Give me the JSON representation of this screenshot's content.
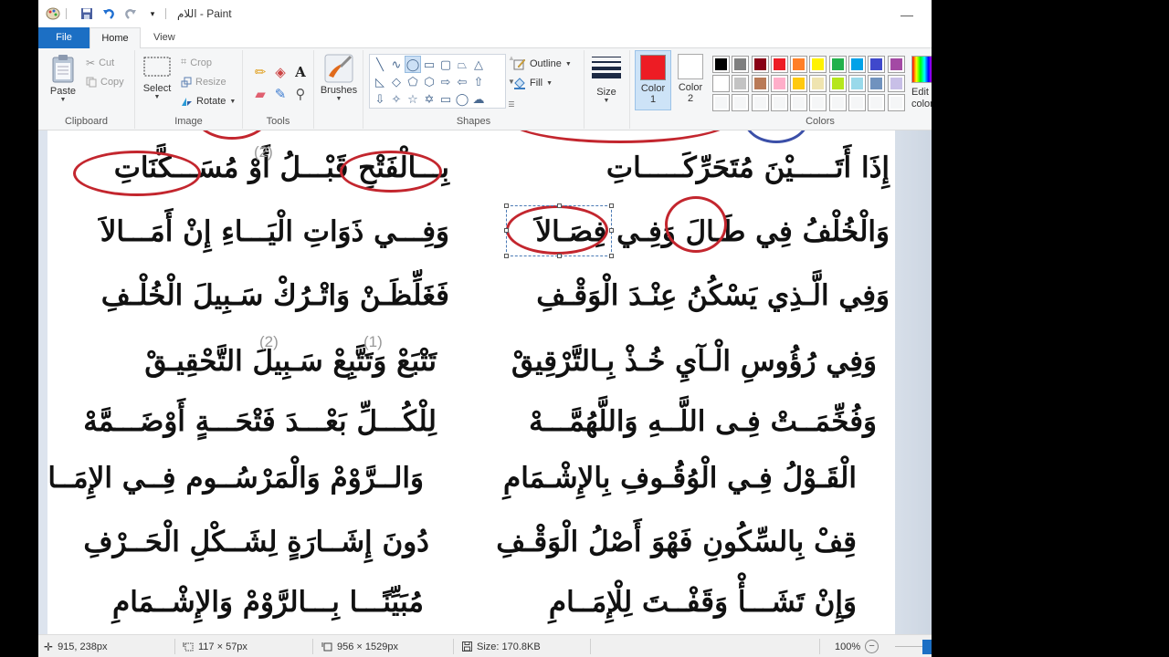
{
  "window": {
    "title": "اللام - Paint",
    "minimize_glyph": "—"
  },
  "quick_access": [
    {
      "name": "paint-app-icon",
      "glyph": "🎨"
    },
    {
      "name": "save-icon",
      "glyph": "💾"
    },
    {
      "name": "undo-icon",
      "glyph": "↶"
    },
    {
      "name": "redo-icon",
      "glyph": "↷"
    },
    {
      "name": "customize-dropdown-icon",
      "glyph": "▾"
    }
  ],
  "tabs": {
    "file": "File",
    "home": "Home",
    "view": "View"
  },
  "ribbon": {
    "clipboard": {
      "label": "Clipboard",
      "paste": "Paste",
      "cut": "Cut",
      "copy": "Copy"
    },
    "image": {
      "label": "Image",
      "select": "Select",
      "crop": "Crop",
      "resize": "Resize",
      "rotate": "Rotate"
    },
    "tools": {
      "label": "Tools",
      "items": [
        {
          "name": "pencil-icon",
          "glyph": "✏"
        },
        {
          "name": "fill-bucket-icon",
          "glyph": "◈"
        },
        {
          "name": "text-tool-icon",
          "glyph": "A"
        },
        {
          "name": "eraser-icon",
          "glyph": "▰"
        },
        {
          "name": "color-picker-icon",
          "glyph": "✎"
        },
        {
          "name": "magnifier-icon",
          "glyph": "⚲"
        }
      ]
    },
    "brushes": {
      "label": "Brushes"
    },
    "shapes": {
      "label": "Shapes",
      "outline": "Outline",
      "fill": "Fill",
      "items": [
        {
          "name": "line-shape",
          "glyph": "╲"
        },
        {
          "name": "curve-shape",
          "glyph": "∿"
        },
        {
          "name": "oval-shape",
          "glyph": "◯",
          "selected": true
        },
        {
          "name": "rectangle-shape",
          "glyph": "▭"
        },
        {
          "name": "rounded-rectangle-shape",
          "glyph": "▢"
        },
        {
          "name": "polygon-shape",
          "glyph": "⏢"
        },
        {
          "name": "triangle-shape",
          "glyph": "△"
        },
        {
          "name": "right-triangle-shape",
          "glyph": "◺"
        },
        {
          "name": "diamond-shape",
          "glyph": "◇"
        },
        {
          "name": "pentagon-shape",
          "glyph": "⬠"
        },
        {
          "name": "hexagon-shape",
          "glyph": "⬡"
        },
        {
          "name": "right-arrow-shape",
          "glyph": "⇨"
        },
        {
          "name": "left-arrow-shape",
          "glyph": "⇦"
        },
        {
          "name": "up-arrow-shape",
          "glyph": "⇧"
        },
        {
          "name": "down-arrow-shape",
          "glyph": "⇩"
        },
        {
          "name": "four-point-star-shape",
          "glyph": "✧"
        },
        {
          "name": "five-point-star-shape",
          "glyph": "☆"
        },
        {
          "name": "six-point-star-shape",
          "glyph": "✡"
        },
        {
          "name": "rounded-callout-shape",
          "glyph": "▭"
        },
        {
          "name": "oval-callout-shape",
          "glyph": "◯"
        },
        {
          "name": "cloud-callout-shape",
          "glyph": "☁"
        }
      ]
    },
    "size": {
      "label": "Size"
    },
    "color1": {
      "label": "Color",
      "number": "1",
      "value": "#ed1c24"
    },
    "color2": {
      "label": "Color",
      "number": "2",
      "value": "#ffffff"
    },
    "colors": {
      "label": "Colors",
      "edit_colors": "Edit colors",
      "palette_row1": [
        "#000000",
        "#7f7f7f",
        "#880015",
        "#ed1c24",
        "#ff7f27",
        "#fff200",
        "#22b14c",
        "#00a2e8",
        "#3f48cc",
        "#a349a4"
      ],
      "palette_row2": [
        "#ffffff",
        "#c3c3c3",
        "#b97a57",
        "#ffaec9",
        "#ffc90e",
        "#efe4b0",
        "#b5e61d",
        "#99d9ea",
        "#7092be",
        "#c8bfe7"
      ],
      "palette_row3": [
        "",
        "",
        "",
        "",
        "",
        "",
        "",
        "",
        "",
        ""
      ]
    }
  },
  "document": {
    "right_column": [
      "إِذَا أَتَـــــيْنَ مُتَحَرِّكَـــــاتِ",
      "وَالْخُلْفُ فِي طَـالَ وَفِـي فِصَـالاَ",
      "وَفِي الَّـذِي يَسْكُنُ عِنْـدَ الْوَقْـفِ",
      "وَفِي رُؤُوسِ الْـآيِ خُـذْ بِـالتَّرْقِيقْ",
      "وَفُخِّمَــتْ فِـى اللَّــهِ وَاللَّهُمَّـــهْ",
      "الْقَـوْلُ فِـي الْوُقُـوفِ بِالإِشْـمَامِ",
      "قِفْ بِالسِّكُونِ فَهْوَ أَصْلُ الْوَقْـفِ",
      "وَإِنْ تَشَـــأْ وَقَفْــتَ لِلْإِمَــامِ"
    ],
    "left_column": [
      "بِـــالْفَتْحِ قَبْـــلُ أَوْ مُسَـــكَّنَاتِ",
      "وَفِـــي ذَوَاتِ الْيَـــاءِ إِنْ أَمَـــالاَ",
      "فَغَلِّظَـنْ وَاتْـرُكْ سَـبِيلَ الْخُلْـفِ",
      "تَتْبَعْ وَتَتَّبِعْ سَـبِيلَ التَّحْقِيـقْ",
      "لِلْكُـــلِّ بَعْـــدَ فَتْحَـــةٍ أَوْضَـــمَّهْ",
      "وَالــرَّوْمْ وَالْمَرْسُــوم فِــي الإِمَــامِ",
      "دُونَ إِشَــارَةٍ لِشَــكْلِ الْحَــرْفِ",
      "مُبَيِّنًـــا بِـــالرَّوْمْ وَالإِشْــمَامِ"
    ],
    "footnotes": {
      "f1": "(2)",
      "f2": "(2)",
      "f3": "(1)"
    }
  },
  "statusbar": {
    "cursor_position": "915, 238px",
    "selection_size": "117 × 57px",
    "image_size": "956 × 1529px",
    "file_size": "Size: 170.8KB",
    "zoom_level": "100%",
    "zoom_percent": 100
  }
}
